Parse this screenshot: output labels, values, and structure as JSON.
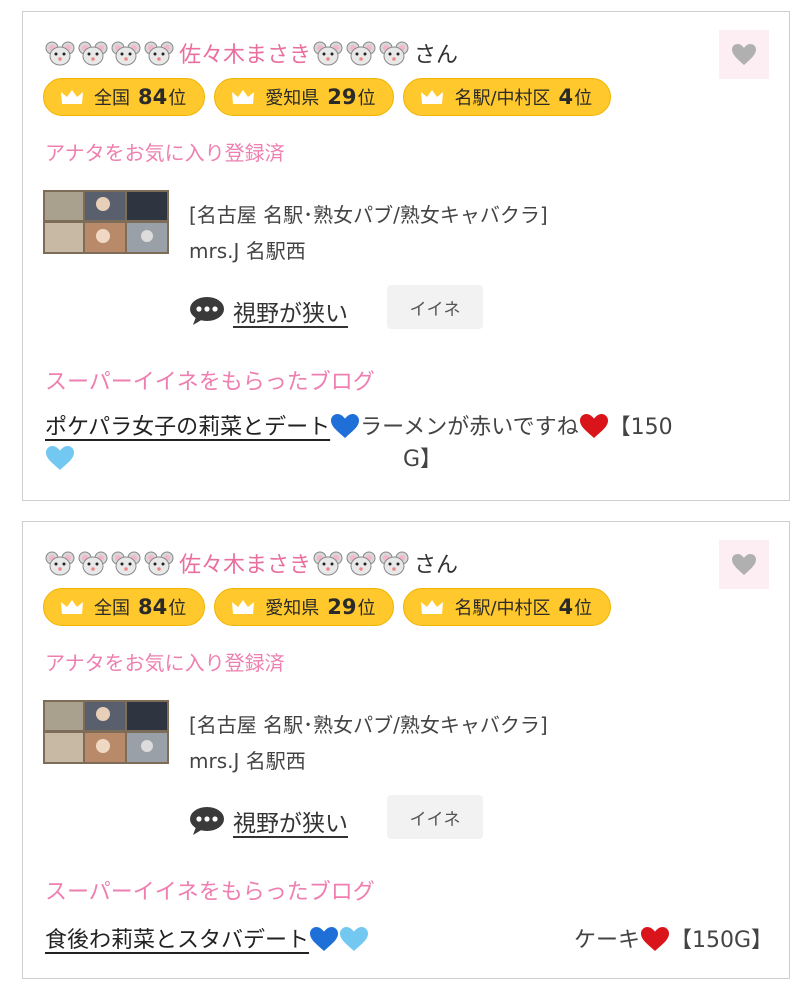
{
  "cards": [
    {
      "name": "佐々木まさき",
      "honorific": "さん",
      "ranks": [
        {
          "area": "全国",
          "num": "84",
          "suffix": "位"
        },
        {
          "area": "愛知県",
          "num": "29",
          "suffix": "位"
        },
        {
          "area": "名駅/中村区",
          "num": "4",
          "suffix": "位"
        }
      ],
      "fav_status": "アナタをお気に入り登録済",
      "shop_category": "[名古屋 名駅･熟女パブ/熟女キャバクラ]",
      "shop_name": "mrs.J 名駅西",
      "comment": "視野が狭い",
      "iine_label": "イイネ",
      "super_label": "スーパーイイネをもらったブログ",
      "blog_title": "ポケパラ女子の莉菜とデート",
      "blog_extra": "ラーメンが赤いですね",
      "blog_price": "【150",
      "blog_price_end": "G】"
    },
    {
      "name": "佐々木まさき",
      "honorific": "さん",
      "ranks": [
        {
          "area": "全国",
          "num": "84",
          "suffix": "位"
        },
        {
          "area": "愛知県",
          "num": "29",
          "suffix": "位"
        },
        {
          "area": "名駅/中村区",
          "num": "4",
          "suffix": "位"
        }
      ],
      "fav_status": "アナタをお気に入り登録済",
      "shop_category": "[名古屋 名駅･熟女パブ/熟女キャバクラ]",
      "shop_name": "mrs.J 名駅西",
      "comment": "視野が狭い",
      "iine_label": "イイネ",
      "super_label": "スーパーイイネをもらったブログ",
      "blog_title": "食後わ莉菜とスタバデート",
      "blog_extra": "ケーキ",
      "blog_price": "【150G】"
    }
  ],
  "icons": {
    "mouse": "mouse-face-emoji",
    "heart": "heart-icon",
    "crown": "crown-icon",
    "bubble": "speech-bubble-icon",
    "blue_heart": "blue-heart-emoji",
    "light_blue_heart": "light-blue-heart-emoji",
    "red_heart": "red-heart-emoji"
  },
  "colors": {
    "accent_pink": "#ee7fb0",
    "rank_yellow": "#ffc82c",
    "fav_bg": "#fdeef3"
  }
}
